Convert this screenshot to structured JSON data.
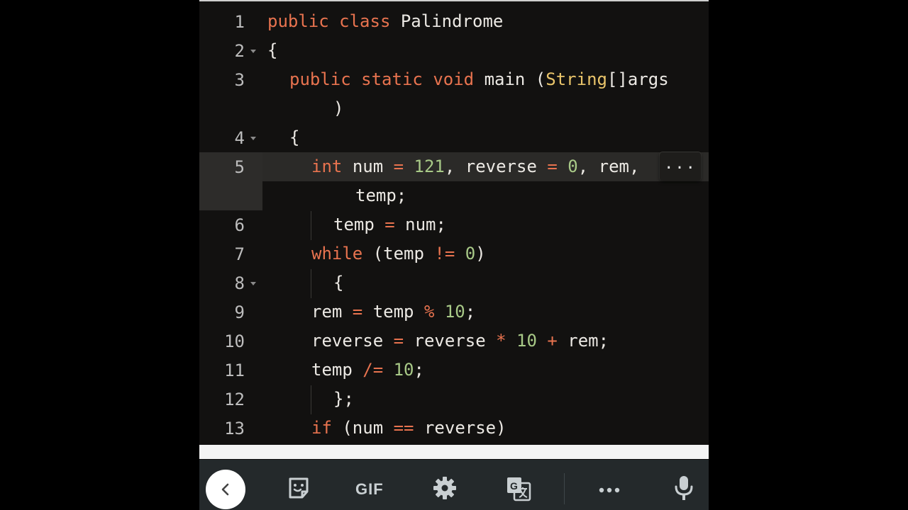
{
  "editor": {
    "lines": [
      {
        "num": "1"
      },
      {
        "num": "2"
      },
      {
        "num": "3"
      },
      {
        "num": "4"
      },
      {
        "num": "5"
      },
      {
        "num": "6"
      },
      {
        "num": "7"
      },
      {
        "num": "8"
      },
      {
        "num": "9"
      },
      {
        "num": "10"
      },
      {
        "num": "11"
      },
      {
        "num": "12"
      },
      {
        "num": "13"
      }
    ],
    "overflow_indicator": "...",
    "code": {
      "l1_public": "public",
      "l1_class": "class",
      "l1_name": "Palindrome",
      "l2_brace": "{",
      "l3_public": "public",
      "l3_static": "static",
      "l3_void": "void",
      "l3_main": "main (",
      "l3_type": "String",
      "l3_args": "[]args",
      "l3_close": ")",
      "l4_brace": "{",
      "l5_int": "int",
      "l5_a": "num ",
      "l5_eq1": "=",
      "l5_121": " 121",
      "l5_b": ", reverse ",
      "l5_eq2": "=",
      "l5_0": " 0",
      "l5_c": ", rem,",
      "l5_temp": "temp;",
      "l6_a": "temp ",
      "l6_eq": "=",
      "l6_b": " num;",
      "l7_while": "while",
      "l7_a": " (temp ",
      "l7_ne": "!=",
      "l7_0": " 0",
      "l7_b": ")",
      "l8_brace": "{",
      "l9_a": "rem ",
      "l9_eq": "=",
      "l9_b": " temp ",
      "l9_mod": "%",
      "l9_10": " 10",
      "l9_c": ";",
      "l10_a": "reverse ",
      "l10_eq": "=",
      "l10_b": " reverse ",
      "l10_mul": "*",
      "l10_10": " 10",
      "l10_sp": " ",
      "l10_plus": "+",
      "l10_c": " rem;",
      "l11_a": "temp ",
      "l11_div": "/=",
      "l11_10": " 10",
      "l11_c": ";",
      "l12_brace": "};",
      "l13_if": "if",
      "l13_a": " (num ",
      "l13_eq": "==",
      "l13_b": " reverse)"
    }
  },
  "keyboard_toolbar": {
    "gif_label": "GIF",
    "icons": [
      "back-arrow-icon",
      "sticker-icon",
      "gif-icon",
      "gear-icon",
      "translate-icon",
      "more-icon",
      "microphone-icon"
    ]
  },
  "colors": {
    "background": "#121110",
    "keyword": "#e8734f",
    "number": "#a8c987",
    "type": "#e9c46a",
    "text": "#ece9e4",
    "line_number": "#bdbdbd",
    "keyboard_bar": "#24292b"
  }
}
